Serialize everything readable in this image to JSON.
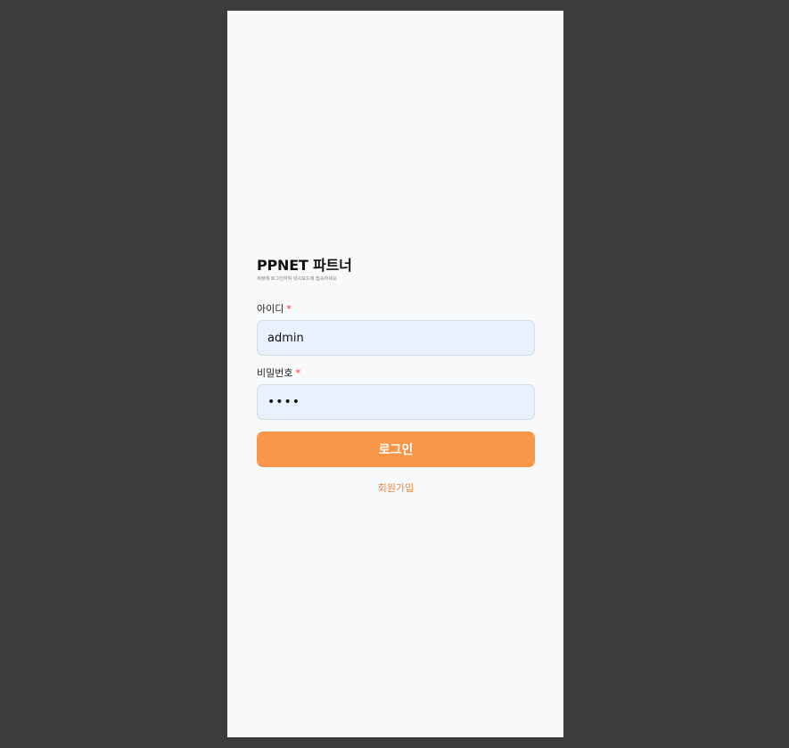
{
  "app": {
    "title": "PPNET 파트너",
    "subtitle": "계정에 로그인하여 대시보드에 접속하세요"
  },
  "form": {
    "id_label": "아이디",
    "id_required_mark": "*",
    "id_value": "admin",
    "password_label": "비밀번호",
    "password_required_mark": "*",
    "password_value": "••••",
    "login_label": "로그인",
    "signup_label": "회원가입"
  },
  "colors": {
    "background_outer": "#3c3c3c",
    "page_background": "#f8f9fb",
    "input_background": "#e9f0fe",
    "primary_button": "#f9964a",
    "signup_link": "#e8843a",
    "required_mark": "#e3342f"
  }
}
